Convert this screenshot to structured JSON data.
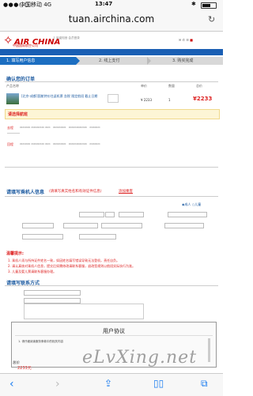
{
  "status": {
    "signal": "●●●○○",
    "carrier": "中国移动 4G",
    "time": "13:47",
    "bt": "✱"
  },
  "url": "tuan.airchina.com",
  "header": {
    "brand": "AIR CHINA",
    "brand_cn": "中国国际航空公司",
    "tagline": "凤凰知音 会员登录"
  },
  "steps": [
    "1. 填写用户信息",
    "2. 线上支付",
    "3. 购买完成"
  ],
  "order": {
    "title": "确认您的订单",
    "columns": [
      "产品名称",
      "单价",
      "数量",
      "总价"
    ],
    "item": "[北京-成都]国航特价往返机票 含税 限定航班 截止日期",
    "price": "¥ 2233",
    "qty": "1",
    "total": "¥2233",
    "notice": "请选择航班",
    "flight1_label": "去程",
    "flight2_label": "回程"
  },
  "passenger": {
    "title": "请填写乘机人信息",
    "subtitle": "(请填写真实姓名和有效证件信息)",
    "add": "添加乘客",
    "options": "成人"
  },
  "notes": {
    "title": "温馨提示:",
    "lines": [
      "1. 乘机人须与所持证件姓名一致，如因姓名填写错误导致无法登机，责任自负。",
      "2. 请认真核对乘机人信息，提交后如需修改请联系客服，退改签规则以航班实际执行为准。",
      "3. 儿童及婴儿票请联系客服办理。"
    ]
  },
  "contact": {
    "title": "请填写联系方式"
  },
  "modal": {
    "title": "用户协议",
    "line": "1. 请仔细阅读服务条款中的相关内容"
  },
  "total": {
    "label": "总价",
    "value": "2233元"
  },
  "watermark": "eLvXing.net"
}
